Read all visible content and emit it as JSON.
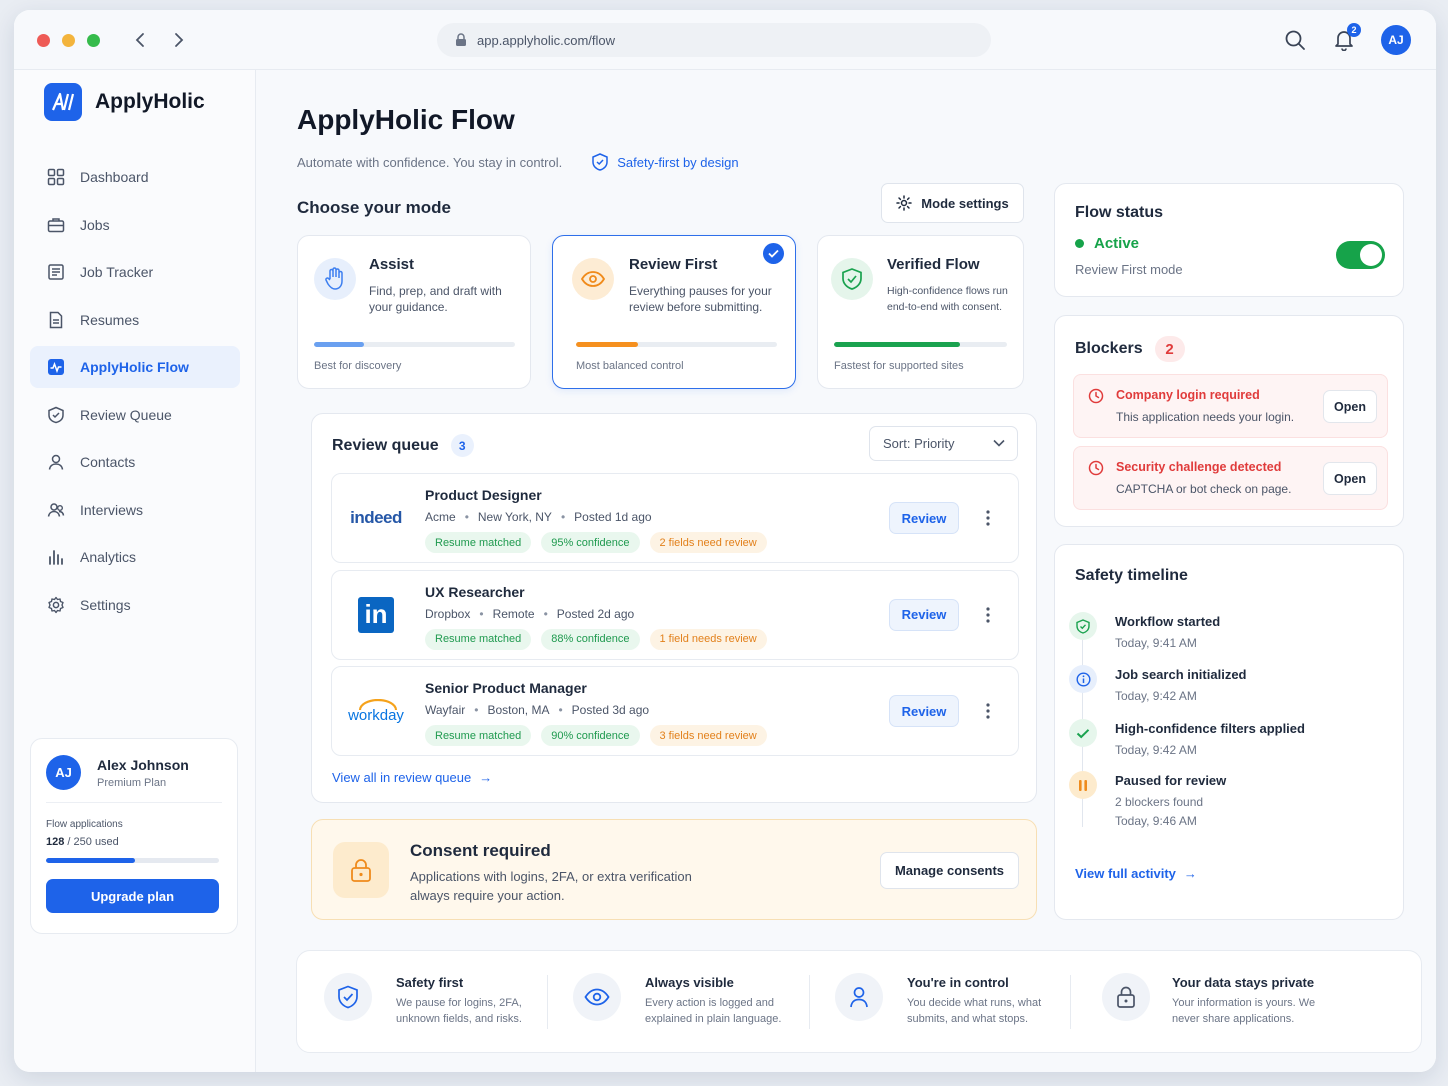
{
  "browser": {
    "url": "app.applyholic.com/flow",
    "notification_count": "2",
    "avatar_initials": "AJ"
  },
  "sidebar": {
    "logo_mark": "AJ",
    "brand": "ApplyHolic",
    "items": [
      {
        "label": "Dashboard",
        "icon": "grid-icon"
      },
      {
        "label": "Jobs",
        "icon": "briefcase-icon"
      },
      {
        "label": "Job Tracker",
        "icon": "tracker-icon"
      },
      {
        "label": "Resumes",
        "icon": "document-icon"
      },
      {
        "label": "ApplyHolic Flow",
        "icon": "flow-icon"
      },
      {
        "label": "Review Queue",
        "icon": "review-icon"
      },
      {
        "label": "Contacts",
        "icon": "user-icon"
      },
      {
        "label": "Interviews",
        "icon": "users-icon"
      },
      {
        "label": "Analytics",
        "icon": "bar-chart-icon"
      },
      {
        "label": "Settings",
        "icon": "gear-icon"
      }
    ],
    "active_index": 4,
    "user": {
      "initials": "AJ",
      "name": "Alex Johnson",
      "plan": "Premium Plan",
      "usage_label": "Flow applications",
      "used": "128",
      "limit_text": "/ 250 used",
      "usage_fraction": 0.512,
      "upgrade_label": "Upgrade plan"
    }
  },
  "header": {
    "title": "ApplyHolic Flow",
    "subtitle": "Automate with confidence. You stay in control.",
    "safety_label": "Safety-first by design"
  },
  "modes": {
    "heading": "Choose your mode",
    "settings_label": "Mode settings",
    "items": [
      {
        "title": "Assist",
        "desc": "Find, prep, and draft with your guidance.",
        "caption": "Best for discovery",
        "level": 0.25,
        "color": "#6aa0f0"
      },
      {
        "title": "Review First",
        "desc": "Everything pauses for your review before submitting.",
        "caption": "Most balanced control",
        "level": 0.31,
        "color": "#f5901f"
      },
      {
        "title": "Verified Flow",
        "desc": "High-confidence flows run end-to-end with consent.",
        "caption": "Fastest for supported sites",
        "level": 0.73,
        "color": "#1aa24f"
      }
    ],
    "selected_index": 1
  },
  "review_queue": {
    "title": "Review queue",
    "count": "3",
    "sort_label": "Sort: Priority",
    "review_label": "Review",
    "jobs": [
      {
        "logo": "indeed",
        "title": "Product Designer",
        "company": "Acme",
        "location": "New York, NY",
        "posted": "Posted 1d ago",
        "tags": [
          "Resume matched",
          "95% confidence",
          "2 fields need review"
        ]
      },
      {
        "logo": "in",
        "title": "UX Researcher",
        "company": "Dropbox",
        "location": "Remote",
        "posted": "Posted 2d ago",
        "tags": [
          "Resume matched",
          "88% confidence",
          "1 field needs review"
        ]
      },
      {
        "logo": "workday",
        "title": "Senior Product Manager",
        "company": "Wayfair",
        "location": "Boston, MA",
        "posted": "Posted 3d ago",
        "tags": [
          "Resume matched",
          "90% confidence",
          "3 fields need review"
        ]
      }
    ],
    "view_all": "View all in review queue",
    "arrow": "→"
  },
  "consent": {
    "title": "Consent required",
    "desc": "Applications with logins, 2FA, or extra verification always require your action.",
    "button": "Manage consents"
  },
  "flow_status": {
    "title": "Flow status",
    "status": "Active",
    "mode": "Review First mode",
    "status_color": "#16a34a"
  },
  "blockers": {
    "title": "Blockers",
    "count": "2",
    "open_label": "Open",
    "items": [
      {
        "title": "Company login required",
        "desc": "This application needs your login."
      },
      {
        "title": "Security challenge detected",
        "desc": "CAPTCHA or bot check on page."
      }
    ]
  },
  "timeline": {
    "title": "Safety timeline",
    "events": [
      {
        "title": "Workflow started",
        "sub": "Today, 9:41 AM",
        "sub2": "",
        "kind": "shield-check"
      },
      {
        "title": "Job search initialized",
        "sub": "Today, 9:42 AM",
        "sub2": "",
        "kind": "info"
      },
      {
        "title": "High-confidence filters applied",
        "sub": "Today, 9:42 AM",
        "sub2": "",
        "kind": "check"
      },
      {
        "title": "Paused for review",
        "sub": "2 blockers found",
        "sub2": "Today, 9:46 AM",
        "kind": "pause"
      }
    ],
    "view_full": "View full activity",
    "arrow": "→"
  },
  "features": [
    {
      "title": "Safety first",
      "desc": "We pause for logins, 2FA, unknown fields, and risks.",
      "icon": "shield-icon"
    },
    {
      "title": "Always visible",
      "desc": "Every action is logged and explained in plain language.",
      "icon": "eye-icon"
    },
    {
      "title": "You're in control",
      "desc": "You decide what runs, what submits, and what stops.",
      "icon": "person-icon"
    },
    {
      "title": "Your data stays private",
      "desc": "Your information is yours. We never share applications.",
      "icon": "lock-icon"
    }
  ]
}
